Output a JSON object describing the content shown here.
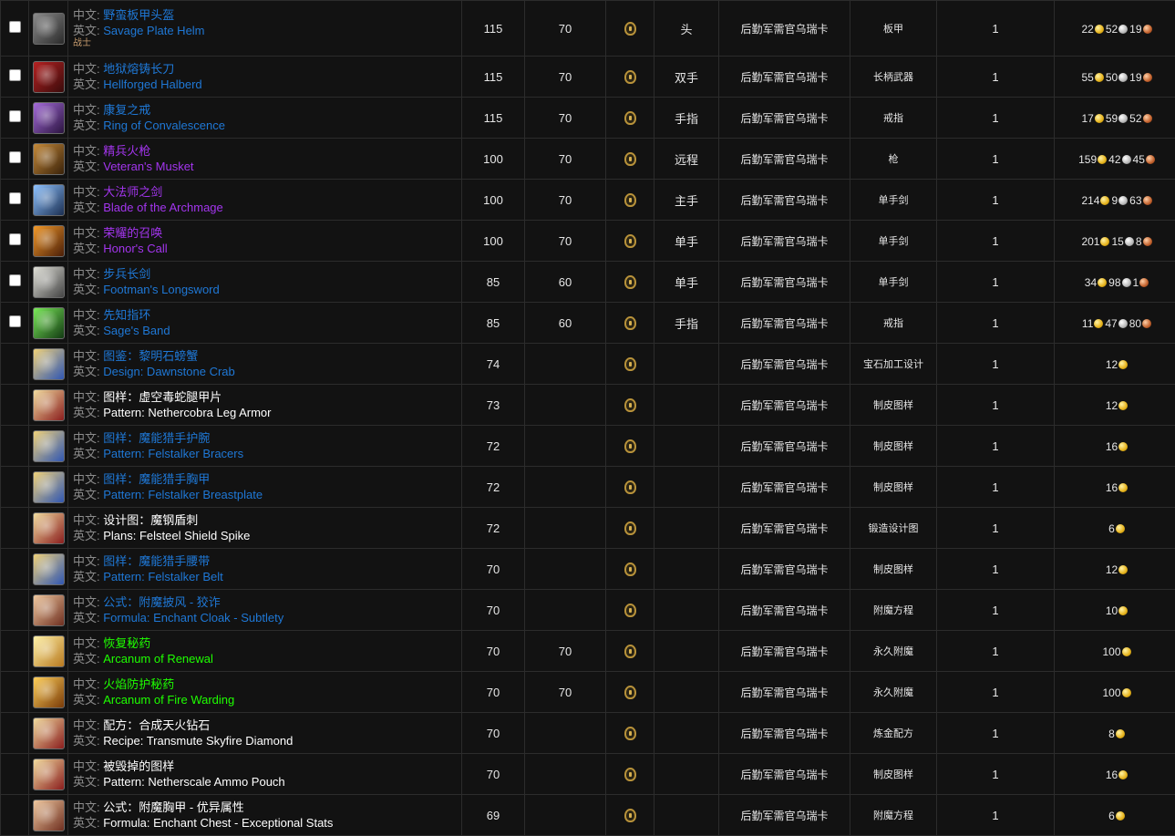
{
  "labels": {
    "cn": "中文: ",
    "en": "英文: "
  },
  "rows": [
    {
      "icon": "ic-helm",
      "icon_name": "plate-helm-icon",
      "cn": "野蛮板甲头盔",
      "en": "Savage Plate Helm",
      "quality": "q-rare",
      "class_req": "战士",
      "checkbox": true,
      "level": "115",
      "req": "70",
      "slot": "头",
      "source": "后勤军需官乌瑞卡",
      "type": "板甲",
      "stack": "1",
      "price": {
        "g": "22",
        "s": "52",
        "c": "19"
      }
    },
    {
      "icon": "ic-halberd",
      "icon_name": "halberd-icon",
      "cn": "地狱熔铸长刀",
      "en": "Hellforged Halberd",
      "quality": "q-rare",
      "class_req": "",
      "checkbox": true,
      "level": "115",
      "req": "70",
      "slot": "双手",
      "source": "后勤军需官乌瑞卡",
      "type": "长柄武器",
      "stack": "1",
      "price": {
        "g": "55",
        "s": "50",
        "c": "19"
      }
    },
    {
      "icon": "ic-ring-purple",
      "icon_name": "ring-icon",
      "cn": "康复之戒",
      "en": "Ring of Convalescence",
      "quality": "q-rare",
      "class_req": "",
      "checkbox": true,
      "level": "115",
      "req": "70",
      "slot": "手指",
      "source": "后勤军需官乌瑞卡",
      "type": "戒指",
      "stack": "1",
      "price": {
        "g": "17",
        "s": "59",
        "c": "52"
      }
    },
    {
      "icon": "ic-musket",
      "icon_name": "musket-icon",
      "cn": "精兵火枪",
      "en": "Veteran's Musket",
      "quality": "q-epic",
      "class_req": "",
      "checkbox": true,
      "level": "100",
      "req": "70",
      "slot": "远程",
      "source": "后勤军需官乌瑞卡",
      "type": "枪",
      "stack": "1",
      "price": {
        "g": "159",
        "s": "42",
        "c": "45"
      }
    },
    {
      "icon": "ic-sword-blue",
      "icon_name": "sword-icon",
      "cn": "大法师之剑",
      "en": "Blade of the Archmage",
      "quality": "q-epic",
      "class_req": "",
      "checkbox": true,
      "level": "100",
      "req": "70",
      "slot": "主手",
      "source": "后勤军需官乌瑞卡",
      "type": "单手剑",
      "stack": "1",
      "price": {
        "g": "214",
        "s": "9",
        "c": "63"
      }
    },
    {
      "icon": "ic-sword-orange",
      "icon_name": "sword-icon",
      "cn": "荣耀的召唤",
      "en": "Honor's Call",
      "quality": "q-epic",
      "class_req": "",
      "checkbox": true,
      "level": "100",
      "req": "70",
      "slot": "单手",
      "source": "后勤军需官乌瑞卡",
      "type": "单手剑",
      "stack": "1",
      "price": {
        "g": "201",
        "s": "15",
        "c": "8"
      }
    },
    {
      "icon": "ic-sword-plain",
      "icon_name": "longsword-icon",
      "cn": "步兵长剑",
      "en": "Footman's Longsword",
      "quality": "q-rare",
      "class_req": "",
      "checkbox": true,
      "level": "85",
      "req": "60",
      "slot": "单手",
      "source": "后勤军需官乌瑞卡",
      "type": "单手剑",
      "stack": "1",
      "price": {
        "g": "34",
        "s": "98",
        "c": "1"
      }
    },
    {
      "icon": "ic-ring-green",
      "icon_name": "ring-icon",
      "cn": "先知指环",
      "en": "Sage's Band",
      "quality": "q-rare",
      "class_req": "",
      "checkbox": true,
      "level": "85",
      "req": "60",
      "slot": "手指",
      "source": "后勤军需官乌瑞卡",
      "type": "戒指",
      "stack": "1",
      "price": {
        "g": "11",
        "s": "47",
        "c": "80"
      }
    },
    {
      "icon": "ic-scroll-blue",
      "icon_name": "scroll-icon",
      "cn": "图鉴：黎明石螃蟹",
      "en": "Design: Dawnstone Crab",
      "quality": "q-rare",
      "class_req": "",
      "checkbox": false,
      "level": "74",
      "req": "",
      "slot": "",
      "source": "后勤军需官乌瑞卡",
      "type": "宝石加工设计",
      "stack": "1",
      "price": {
        "g": "12",
        "s": "",
        "c": ""
      }
    },
    {
      "icon": "ic-scroll-red",
      "icon_name": "scroll-icon",
      "cn": "图样：虚空毒蛇腿甲片",
      "en": "Pattern: Nethercobra Leg Armor",
      "quality": "q-common",
      "class_req": "",
      "checkbox": false,
      "level": "73",
      "req": "",
      "slot": "",
      "source": "后勤军需官乌瑞卡",
      "type": "制皮图样",
      "stack": "1",
      "price": {
        "g": "12",
        "s": "",
        "c": ""
      }
    },
    {
      "icon": "ic-scroll-blue",
      "icon_name": "scroll-icon",
      "cn": "图样：魔能猎手护腕",
      "en": "Pattern: Felstalker Bracers",
      "quality": "q-rare",
      "class_req": "",
      "checkbox": false,
      "level": "72",
      "req": "",
      "slot": "",
      "source": "后勤军需官乌瑞卡",
      "type": "制皮图样",
      "stack": "1",
      "price": {
        "g": "16",
        "s": "",
        "c": ""
      }
    },
    {
      "icon": "ic-scroll-blue",
      "icon_name": "scroll-icon",
      "cn": "图样：魔能猎手胸甲",
      "en": "Pattern: Felstalker Breastplate",
      "quality": "q-rare",
      "class_req": "",
      "checkbox": false,
      "level": "72",
      "req": "",
      "slot": "",
      "source": "后勤军需官乌瑞卡",
      "type": "制皮图样",
      "stack": "1",
      "price": {
        "g": "16",
        "s": "",
        "c": ""
      }
    },
    {
      "icon": "ic-scroll-red",
      "icon_name": "scroll-icon",
      "cn": "设计图：魔钢盾刺",
      "en": "Plans: Felsteel Shield Spike",
      "quality": "q-common",
      "class_req": "",
      "checkbox": false,
      "level": "72",
      "req": "",
      "slot": "",
      "source": "后勤军需官乌瑞卡",
      "type": "锻造设计图",
      "stack": "1",
      "price": {
        "g": "6",
        "s": "",
        "c": ""
      }
    },
    {
      "icon": "ic-scroll-blue",
      "icon_name": "scroll-icon",
      "cn": "图样：魔能猎手腰带",
      "en": "Pattern: Felstalker Belt",
      "quality": "q-rare",
      "class_req": "",
      "checkbox": false,
      "level": "70",
      "req": "",
      "slot": "",
      "source": "后勤军需官乌瑞卡",
      "type": "制皮图样",
      "stack": "1",
      "price": {
        "g": "12",
        "s": "",
        "c": ""
      }
    },
    {
      "icon": "ic-formula",
      "icon_name": "formula-icon",
      "cn": "公式：附魔披风 - 狡诈",
      "en": "Formula: Enchant Cloak - Subtlety",
      "quality": "q-rare",
      "class_req": "",
      "checkbox": false,
      "level": "70",
      "req": "",
      "slot": "",
      "source": "后勤军需官乌瑞卡",
      "type": "附魔方程",
      "stack": "1",
      "price": {
        "g": "10",
        "s": "",
        "c": ""
      }
    },
    {
      "icon": "ic-arcanum-renew",
      "icon_name": "arcanum-icon",
      "cn": "恢复秘药",
      "en": "Arcanum of Renewal",
      "quality": "q-uncommon",
      "class_req": "",
      "checkbox": false,
      "level": "70",
      "req": "70",
      "slot": "",
      "source": "后勤军需官乌瑞卡",
      "type": "永久附魔",
      "stack": "1",
      "price": {
        "g": "100",
        "s": "",
        "c": ""
      }
    },
    {
      "icon": "ic-arcanum-fire",
      "icon_name": "arcanum-icon",
      "cn": "火焰防护秘药",
      "en": "Arcanum of Fire Warding",
      "quality": "q-uncommon",
      "class_req": "",
      "checkbox": false,
      "level": "70",
      "req": "70",
      "slot": "",
      "source": "后勤军需官乌瑞卡",
      "type": "永久附魔",
      "stack": "1",
      "price": {
        "g": "100",
        "s": "",
        "c": ""
      }
    },
    {
      "icon": "ic-scroll-red",
      "icon_name": "scroll-icon",
      "cn": "配方：合成天火钻石",
      "en": "Recipe: Transmute Skyfire Diamond",
      "quality": "q-common",
      "class_req": "",
      "checkbox": false,
      "level": "70",
      "req": "",
      "slot": "",
      "source": "后勤军需官乌瑞卡",
      "type": "炼金配方",
      "stack": "1",
      "price": {
        "g": "8",
        "s": "",
        "c": ""
      }
    },
    {
      "icon": "ic-scroll-red",
      "icon_name": "scroll-icon",
      "cn": "被毁掉的图样",
      "en": "Pattern: Netherscale Ammo Pouch",
      "quality": "q-common",
      "class_req": "",
      "checkbox": false,
      "level": "70",
      "req": "",
      "slot": "",
      "source": "后勤军需官乌瑞卡",
      "type": "制皮图样",
      "stack": "1",
      "price": {
        "g": "16",
        "s": "",
        "c": ""
      }
    },
    {
      "icon": "ic-formula",
      "icon_name": "formula-icon",
      "cn": "公式：附魔胸甲 - 优异属性",
      "en": "Formula: Enchant Chest - Exceptional Stats",
      "quality": "q-common",
      "class_req": "",
      "checkbox": false,
      "level": "69",
      "req": "",
      "slot": "",
      "source": "后勤军需官乌瑞卡",
      "type": "附魔方程",
      "stack": "1",
      "price": {
        "g": "6",
        "s": "",
        "c": ""
      }
    }
  ]
}
